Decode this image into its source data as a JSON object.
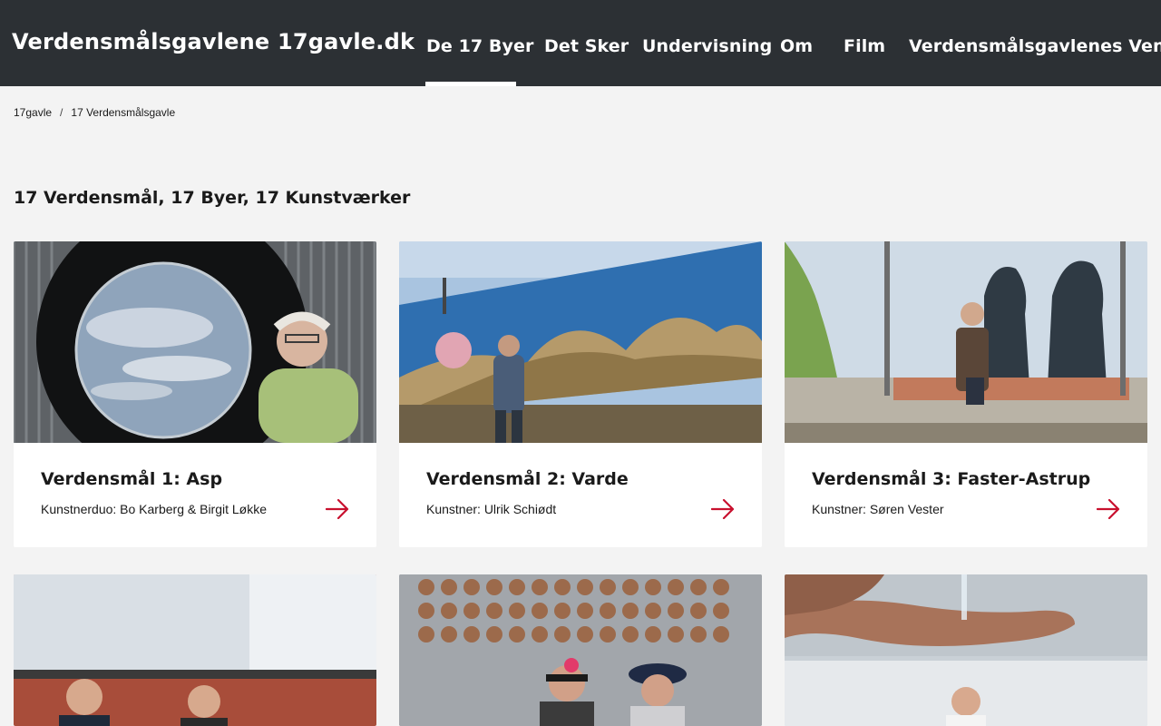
{
  "header": {
    "site_title": "Verdensmålsgavlene 17gavle.dk",
    "nav": [
      {
        "label": "De 17 Byer",
        "active": true
      },
      {
        "label": "Det Sker"
      },
      {
        "label": "Undervisning"
      },
      {
        "label": "Om"
      },
      {
        "label": "Film"
      },
      {
        "label": "Verdensmålsgavlenes Venner"
      }
    ]
  },
  "breadcrumb": {
    "items": [
      "17gavle",
      "17 Verdensmålsgavle"
    ],
    "separator": "/"
  },
  "main": {
    "heading": "17 Verdensmål, 17 Byer, 17 Kunstværker",
    "cards": [
      {
        "title": "Verdensmål 1: Asp",
        "subtitle": "Kunstnerduo: Bo Karberg & Birgit Løkke",
        "image": "globe-sculpture-photo"
      },
      {
        "title": "Verdensmål 2: Varde",
        "subtitle": "Kunstner: Ulrik Schiødt",
        "image": "desert-mural-photo"
      },
      {
        "title": "Verdensmål 3: Faster-Astrup",
        "subtitle": "Kunstner: Søren Vester",
        "image": "bench-mural-photo"
      },
      {
        "title": "",
        "subtitle": "",
        "image": "text-mural-photo"
      },
      {
        "title": "",
        "subtitle": "",
        "image": "coin-wall-photo"
      },
      {
        "title": "",
        "subtitle": "",
        "image": "hand-water-mural-photo"
      }
    ]
  },
  "colors": {
    "header_bg": "#2c3034",
    "page_bg": "#f3f3f3",
    "accent_arrow": "#c8102e"
  },
  "icons": {
    "card_arrow": "arrow-right-icon"
  }
}
